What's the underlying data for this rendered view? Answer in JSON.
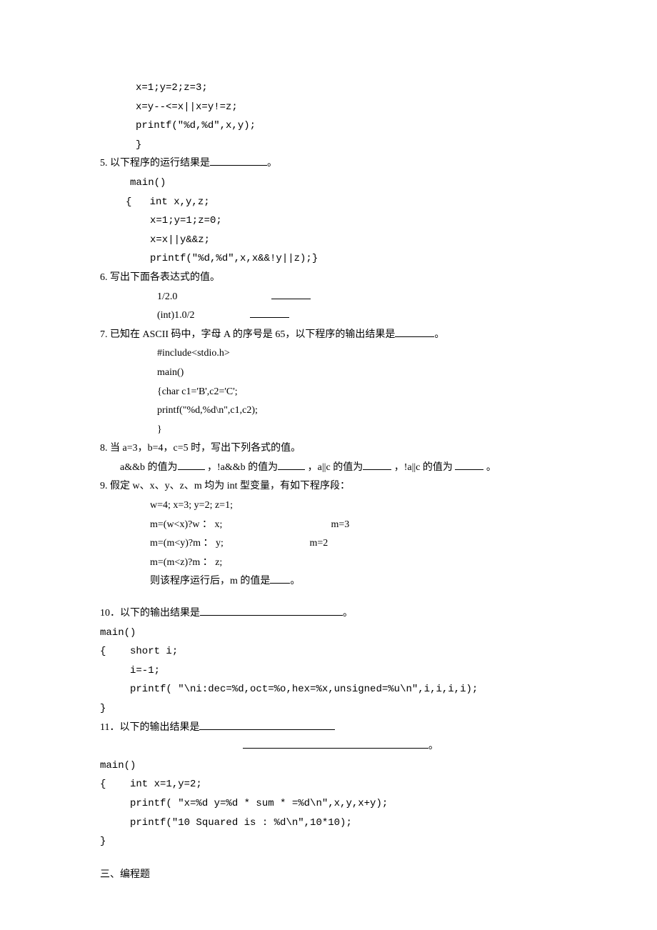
{
  "code4": {
    "l1": "x=1;y=2;z=3;",
    "l2": "x=y--<=x||x=y!=z;",
    "l3": "printf(\"%d,%d\",x,y);",
    "l4": "}"
  },
  "q5": {
    "prompt_a": "5. 以下程序的运行结果是",
    "prompt_b": "。",
    "l1": "main()",
    "l2": "{   int x,y,z;",
    "l3": "x=1;y=1;z=0;",
    "l4": "x=x||y&&z;",
    "l5": "printf(\"%d,%d\",x,x&&!y||z);}"
  },
  "q6": {
    "prompt": "6. 写出下面各表达式的值。",
    "l1": "1/2.0",
    "l2": "(int)1.0/2"
  },
  "q7": {
    "prompt_a": "7. 已知在 ASCII 码中，字母 A 的序号是 65，以下程序的输出结果是",
    "prompt_b": "。",
    "l1": "#include<stdio.h>",
    "l2": "main()",
    "l3": "{char c1='B',c2='C';",
    "l4": " printf(\"%d,%d\\n\",c1,c2);",
    "l5": "}"
  },
  "q8": {
    "prompt": "8. 当 a=3，b=4，c=5 时，写出下列各式的值。",
    "s1a": "a&&b 的值为",
    "s1b": " ，!a&&b 的值为",
    "s1c": "，a||c 的值为",
    "s1d": " ，!a||c 的值为 ",
    "s1e": "。"
  },
  "q9": {
    "prompt": "9. 假定 w、x、y、z、m 均为 int 型变量，有如下程序段：",
    "l1": "w=4; x=3; y=2; z=1;",
    "l2a": "m=(w<x)?w ： x;",
    "l2b": "m=3",
    "l3a": "m=(m<y)?m ： y;",
    "l3b": "m=2",
    "l4": "m=(m<z)?m ： z;",
    "last_a": "则该程序运行后，m 的值是",
    "last_b": "。"
  },
  "q10": {
    "prompt_a": "10．以下的输出结果是",
    "prompt_b": "。",
    "l1": "main()",
    "l2": "{    short i;",
    "l3": "     i=-1;",
    "l4": "     printf( \"\\ni:dec=%d,oct=%o,hex=%x,unsigned=%u\\n\",i,i,i,i);",
    "l5": "}"
  },
  "q11": {
    "prompt_a": "11．以下的输出结果是",
    "prompt_b": "。",
    "l1": "main()",
    "l2": "{    int x=1,y=2;",
    "l3": "     printf( \"x=%d y=%d * sum * =%d\\n\",x,y,x+y);",
    "l4": "     printf(\"10 Squared is : %d\\n\",10*10);",
    "l5": "}"
  },
  "section3": "三、编程题"
}
